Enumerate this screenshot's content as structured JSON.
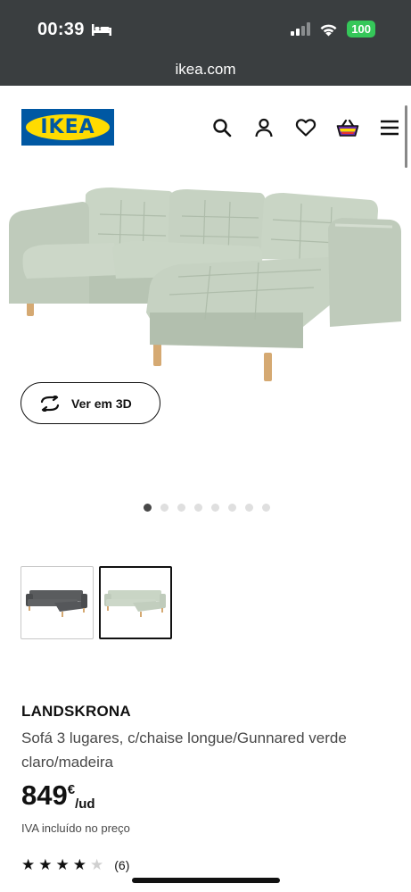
{
  "status_bar": {
    "time": "00:39",
    "battery": "100",
    "icons": [
      "bed-icon",
      "cellular-signal-icon",
      "wifi-icon",
      "battery-icon"
    ]
  },
  "browser": {
    "url": "ikea.com"
  },
  "header": {
    "logo_text": "IKEA",
    "icons": [
      "search-icon",
      "account-icon",
      "wishlist-heart-icon",
      "shopping-bag-icon",
      "menu-icon"
    ]
  },
  "gallery": {
    "view_3d_label": "Ver em 3D",
    "image_count": 8,
    "active_index": 0
  },
  "variants": [
    {
      "color_name": "dark grey",
      "selected": false
    },
    {
      "color_name": "light green",
      "selected": true
    }
  ],
  "product": {
    "name": "LANDSKRONA",
    "description": "Sofá 3 lugares, c/chaise longue/Gunnared verde claro/madeira",
    "price_integer": "849",
    "price_currency": "€",
    "price_unit": "/ud",
    "vat_note": "IVA incluído no preço",
    "rating": 4,
    "rating_max": 5,
    "review_count": "(6)"
  },
  "colors": {
    "status_bg": "#3a3e40",
    "ikea_blue": "#0058a3",
    "ikea_yellow": "#ffdb00",
    "sofa_green": "#c6d2c2",
    "battery_green": "#35c759"
  }
}
